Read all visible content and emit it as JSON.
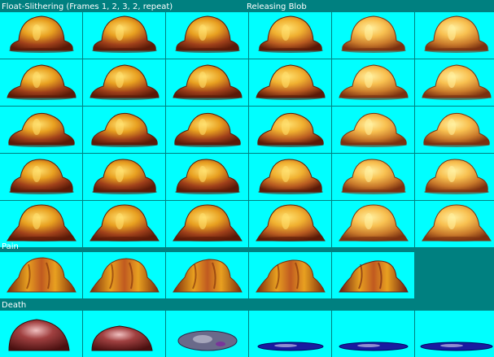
{
  "colors": {
    "background": "#008080",
    "cell": "#00ffff",
    "label": "#ffffff",
    "blob_dark": "#5a1a08",
    "blob_mid": "#a0401a",
    "blob_light": "#e8a020",
    "blob_highlight": "#ffe070",
    "pain_mid": "#c05a20",
    "death_blue": "#1a1aa0",
    "death_grey": "#6a6a8a"
  },
  "sections": {
    "float": {
      "label": "Float-Slithering (Frames 1, 2, 3, 2, repeat)"
    },
    "releasing": {
      "label": "Releasing Blob"
    },
    "pain": {
      "label": "Pain"
    },
    "death": {
      "label": "Death"
    }
  },
  "main_grid": {
    "rows": [
      [
        "helmet-dark",
        "helmet-dark",
        "helmet-dark",
        "helmet-mid",
        "helmet-light",
        "helmet-light"
      ],
      [
        "wide-dark",
        "wide-dark",
        "wide-dark",
        "wide-mid",
        "wide-light",
        "wide-light"
      ],
      [
        "slant-dark",
        "slant-dark",
        "slant-dark",
        "slant-mid",
        "slant-light",
        "slant-light"
      ],
      [
        "lump-dark",
        "lump-dark",
        "lump-dark",
        "lump-mid",
        "lump-light",
        "lump-light"
      ],
      [
        "bell-dark",
        "bell-dark",
        "bell-dark",
        "bell-mid",
        "bell-light",
        "bell-light"
      ]
    ]
  },
  "pain_row": [
    "pain-1",
    "pain-2",
    "pain-3",
    "pain-4",
    "pain-5",
    null
  ],
  "death_row": [
    "death-1",
    "death-2",
    "death-3",
    "death-4",
    "death-5",
    "death-6"
  ]
}
